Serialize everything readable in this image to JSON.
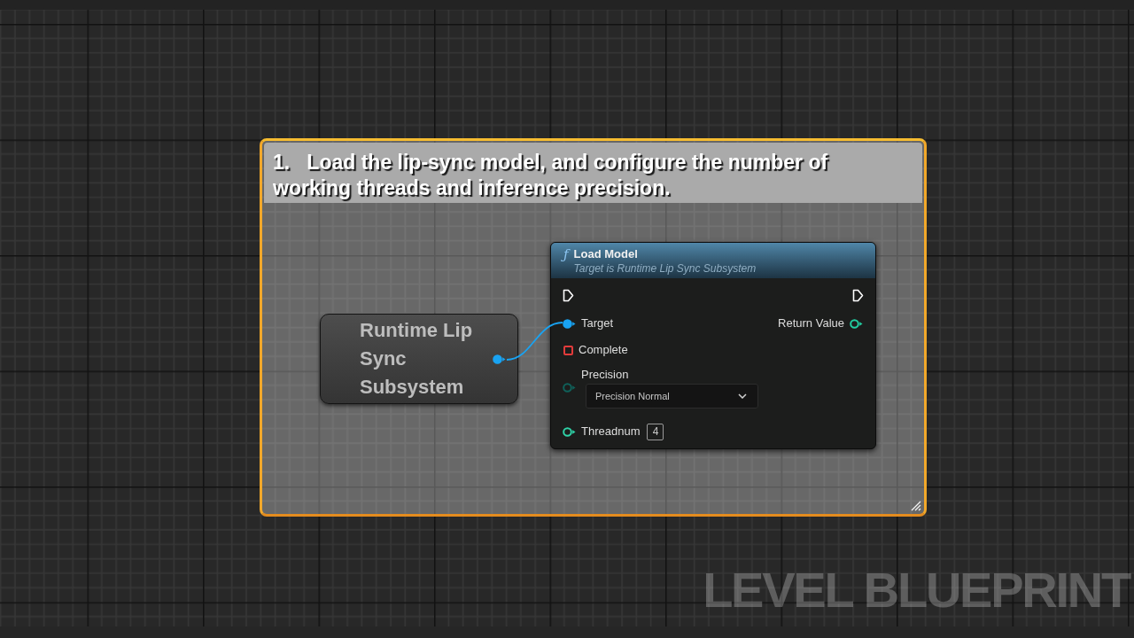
{
  "graph": {
    "comment": {
      "text": "1.   Load the lip-sync model, and configure the number of working threads and inference precision.",
      "selected": true
    },
    "nodes": [
      {
        "kind": "variable",
        "selected": false,
        "title": "Runtime Lip Sync Subsystem",
        "output": {
          "kind": "object",
          "color": "#19a3f2",
          "connected": true
        }
      },
      {
        "kind": "function",
        "selected": false,
        "icon_glyph": "ƒ",
        "title": "Load Model",
        "subtitle": "Target is Runtime Lip Sync Subsystem",
        "exec_in": {
          "kind": "exec",
          "connected": false
        },
        "exec_out": {
          "kind": "exec",
          "connected": false
        },
        "inputs": [
          {
            "kind": "object",
            "label": "Target",
            "color": "#19a3f2",
            "connected": true
          },
          {
            "kind": "delegate",
            "label": "Complete",
            "color": "#e23b3b",
            "connected": false
          },
          {
            "kind": "enum",
            "label": "Precision",
            "color": "#0f615a",
            "connected": false,
            "value": "Precision Normal"
          },
          {
            "kind": "int",
            "label": "Threadnum",
            "color": "#2fd3a8",
            "connected": false,
            "value": "4"
          }
        ],
        "outputs": [
          {
            "kind": "object",
            "label": "Return Value",
            "color": "#22cfa2",
            "connected": false
          }
        ]
      }
    ],
    "label": "LEVEL BLUEPRINT"
  }
}
